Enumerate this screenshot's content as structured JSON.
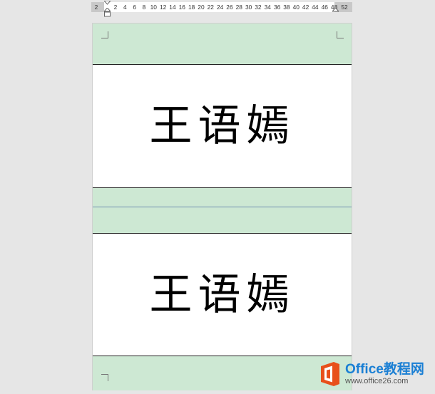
{
  "ruler": {
    "left_value": "2",
    "right_value": "52",
    "ticks": [
      "2",
      "4",
      "6",
      "8",
      "10",
      "12",
      "14",
      "16",
      "18",
      "20",
      "22",
      "24",
      "26",
      "28",
      "30",
      "32",
      "34",
      "36",
      "38",
      "40",
      "42",
      "44",
      "46",
      "48"
    ]
  },
  "document": {
    "cards": [
      {
        "name": "王语嫣"
      },
      {
        "name": "王语嫣"
      }
    ],
    "colors": {
      "band": "#cde8d3",
      "page": "#ffffff",
      "workspace": "#e6e6e6"
    }
  },
  "watermark": {
    "brand": "Office教程网",
    "url": "www.office26.com",
    "logo_icon": "office-logo-icon",
    "accent": "#e8501b"
  }
}
